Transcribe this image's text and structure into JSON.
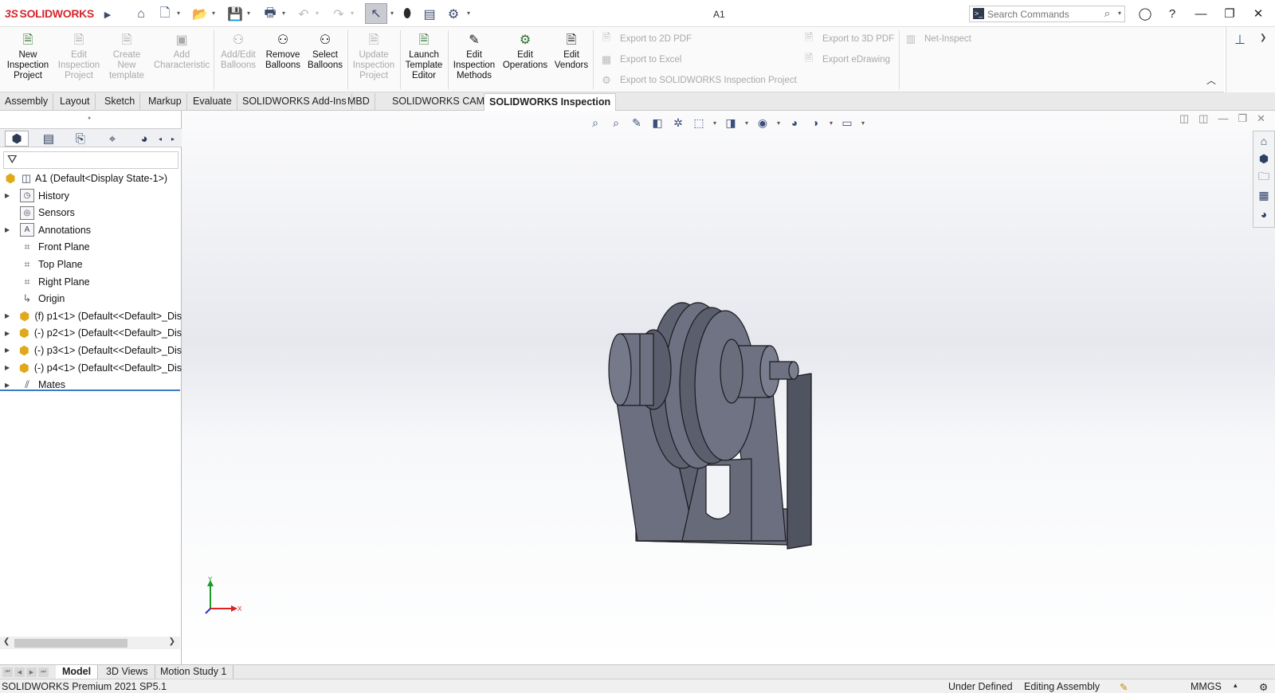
{
  "app": {
    "logo_prefix": "3S",
    "logo_text": "SOLIDWORKS",
    "document_title": "A1"
  },
  "search": {
    "placeholder": "Search Commands"
  },
  "ribbon": {
    "large_buttons": [
      {
        "label": "New Inspection Project",
        "enabled": true
      },
      {
        "label": "Edit Inspection Project",
        "enabled": false
      },
      {
        "label": "Create New template",
        "enabled": false
      },
      {
        "label": "Add Characteristic",
        "enabled": false
      },
      {
        "label": "Add/Edit Balloons",
        "enabled": false
      },
      {
        "label": "Remove Balloons",
        "enabled": true
      },
      {
        "label": "Select Balloons",
        "enabled": true
      },
      {
        "label": "Update Inspection Project",
        "enabled": false
      },
      {
        "label": "Launch Template Editor",
        "enabled": true
      },
      {
        "label": "Edit Inspection Methods",
        "enabled": true
      },
      {
        "label": "Edit Operations",
        "enabled": true
      },
      {
        "label": "Edit Vendors",
        "enabled": true
      }
    ],
    "export_2d_pdf": "Export to 2D PDF",
    "export_excel": "Export to Excel",
    "export_sw_inspection": "Export to SOLIDWORKS Inspection Project",
    "export_3d_pdf": "Export to 3D PDF",
    "export_edrawing": "Export eDrawing",
    "net_inspect": "Net-Inspect"
  },
  "tabs": [
    "Assembly",
    "Layout",
    "Sketch",
    "Markup",
    "Evaluate",
    "SOLIDWORKS Add-Ins",
    "MBD",
    "SOLIDWORKS CAM",
    "SOLIDWORKS Inspection"
  ],
  "active_tab": "SOLIDWORKS Inspection",
  "tree": {
    "root": "A1  (Default<Display State-1>)",
    "items": [
      {
        "label": "History",
        "expandable": true,
        "icon": "history-folder-icon"
      },
      {
        "label": "Sensors",
        "expandable": false,
        "icon": "sensor-folder-icon"
      },
      {
        "label": "Annotations",
        "expandable": true,
        "icon": "annotations-folder-icon"
      },
      {
        "label": "Front Plane",
        "expandable": false,
        "icon": "plane-icon"
      },
      {
        "label": "Top Plane",
        "expandable": false,
        "icon": "plane-icon"
      },
      {
        "label": "Right Plane",
        "expandable": false,
        "icon": "plane-icon"
      },
      {
        "label": "Origin",
        "expandable": false,
        "icon": "origin-icon"
      },
      {
        "label": "(f) p1<1> (Default<<Default>_Dis",
        "expandable": true,
        "icon": "part-icon"
      },
      {
        "label": "(-) p2<1> (Default<<Default>_Dis",
        "expandable": true,
        "icon": "part-icon"
      },
      {
        "label": "(-) p3<1> (Default<<Default>_Dis",
        "expandable": true,
        "icon": "part-icon"
      },
      {
        "label": "(-) p4<1> (Default<<Default>_Dis",
        "expandable": true,
        "icon": "part-icon"
      },
      {
        "label": "Mates",
        "expandable": true,
        "icon": "mates-icon"
      }
    ]
  },
  "triad": {
    "y": "Y",
    "x": "X"
  },
  "bottom_tabs": [
    "Model",
    "3D Views",
    "Motion Study 1"
  ],
  "active_bottom_tab": "Model",
  "status": {
    "version": "SOLIDWORKS Premium 2021 SP5.1",
    "definition": "Under Defined",
    "mode": "Editing Assembly",
    "units": "MMGS"
  },
  "colors": {
    "brand": "#d6262d",
    "model_face": "#6b6e7d",
    "model_edge": "#1a1a1f",
    "selection_blue": "#3b7bc4"
  }
}
